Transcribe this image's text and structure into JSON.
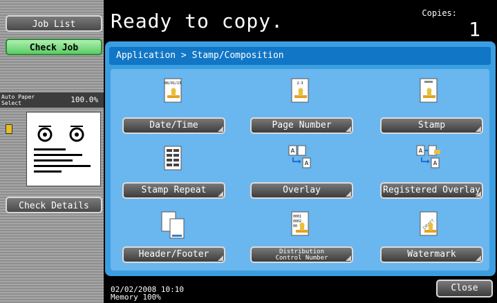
{
  "left": {
    "job_list_label": "Job List",
    "check_job_label": "Check Job",
    "paper_select_label": "Auto Paper Select",
    "zoom": "100.0%",
    "check_details_label": "Check Details"
  },
  "header": {
    "status": "Ready to copy.",
    "copies_label": "Copies:",
    "copies_value": "1"
  },
  "breadcrumb": "Application > Stamp/Composition",
  "functions": [
    {
      "label": "Date/Time",
      "icon": "date-time-stamp-icon",
      "icon_text": "08/01/23"
    },
    {
      "label": "Page Number",
      "icon": "page-number-stamp-icon",
      "icon_text": "2-3"
    },
    {
      "label": "Stamp",
      "icon": "stamp-icon",
      "icon_text": ""
    },
    {
      "label": "Stamp Repeat",
      "icon": "stamp-repeat-icon",
      "icon_text": ""
    },
    {
      "label": "Overlay",
      "icon": "overlay-icon",
      "icon_text": "A"
    },
    {
      "label": "Registered Overlay",
      "icon": "registered-overlay-icon",
      "icon_text": "A"
    },
    {
      "label": "Header/Footer",
      "icon": "header-footer-icon",
      "icon_text": ""
    },
    {
      "label_line1": "Distribution",
      "label_line2": "Control Number",
      "icon": "distribution-number-icon",
      "icon_text": "0001"
    },
    {
      "label": "Watermark",
      "icon": "watermark-icon",
      "icon_text": "DRAFT"
    }
  ],
  "footer": {
    "date_time": "02/02/2008   10:10",
    "memory": "Memory       100%",
    "close_label": "Close"
  },
  "colors": {
    "panel": "#3b9ee0",
    "breadcrumb": "#1276c6",
    "inner": "#6ab6ee",
    "check_job": "#5ccc66"
  }
}
